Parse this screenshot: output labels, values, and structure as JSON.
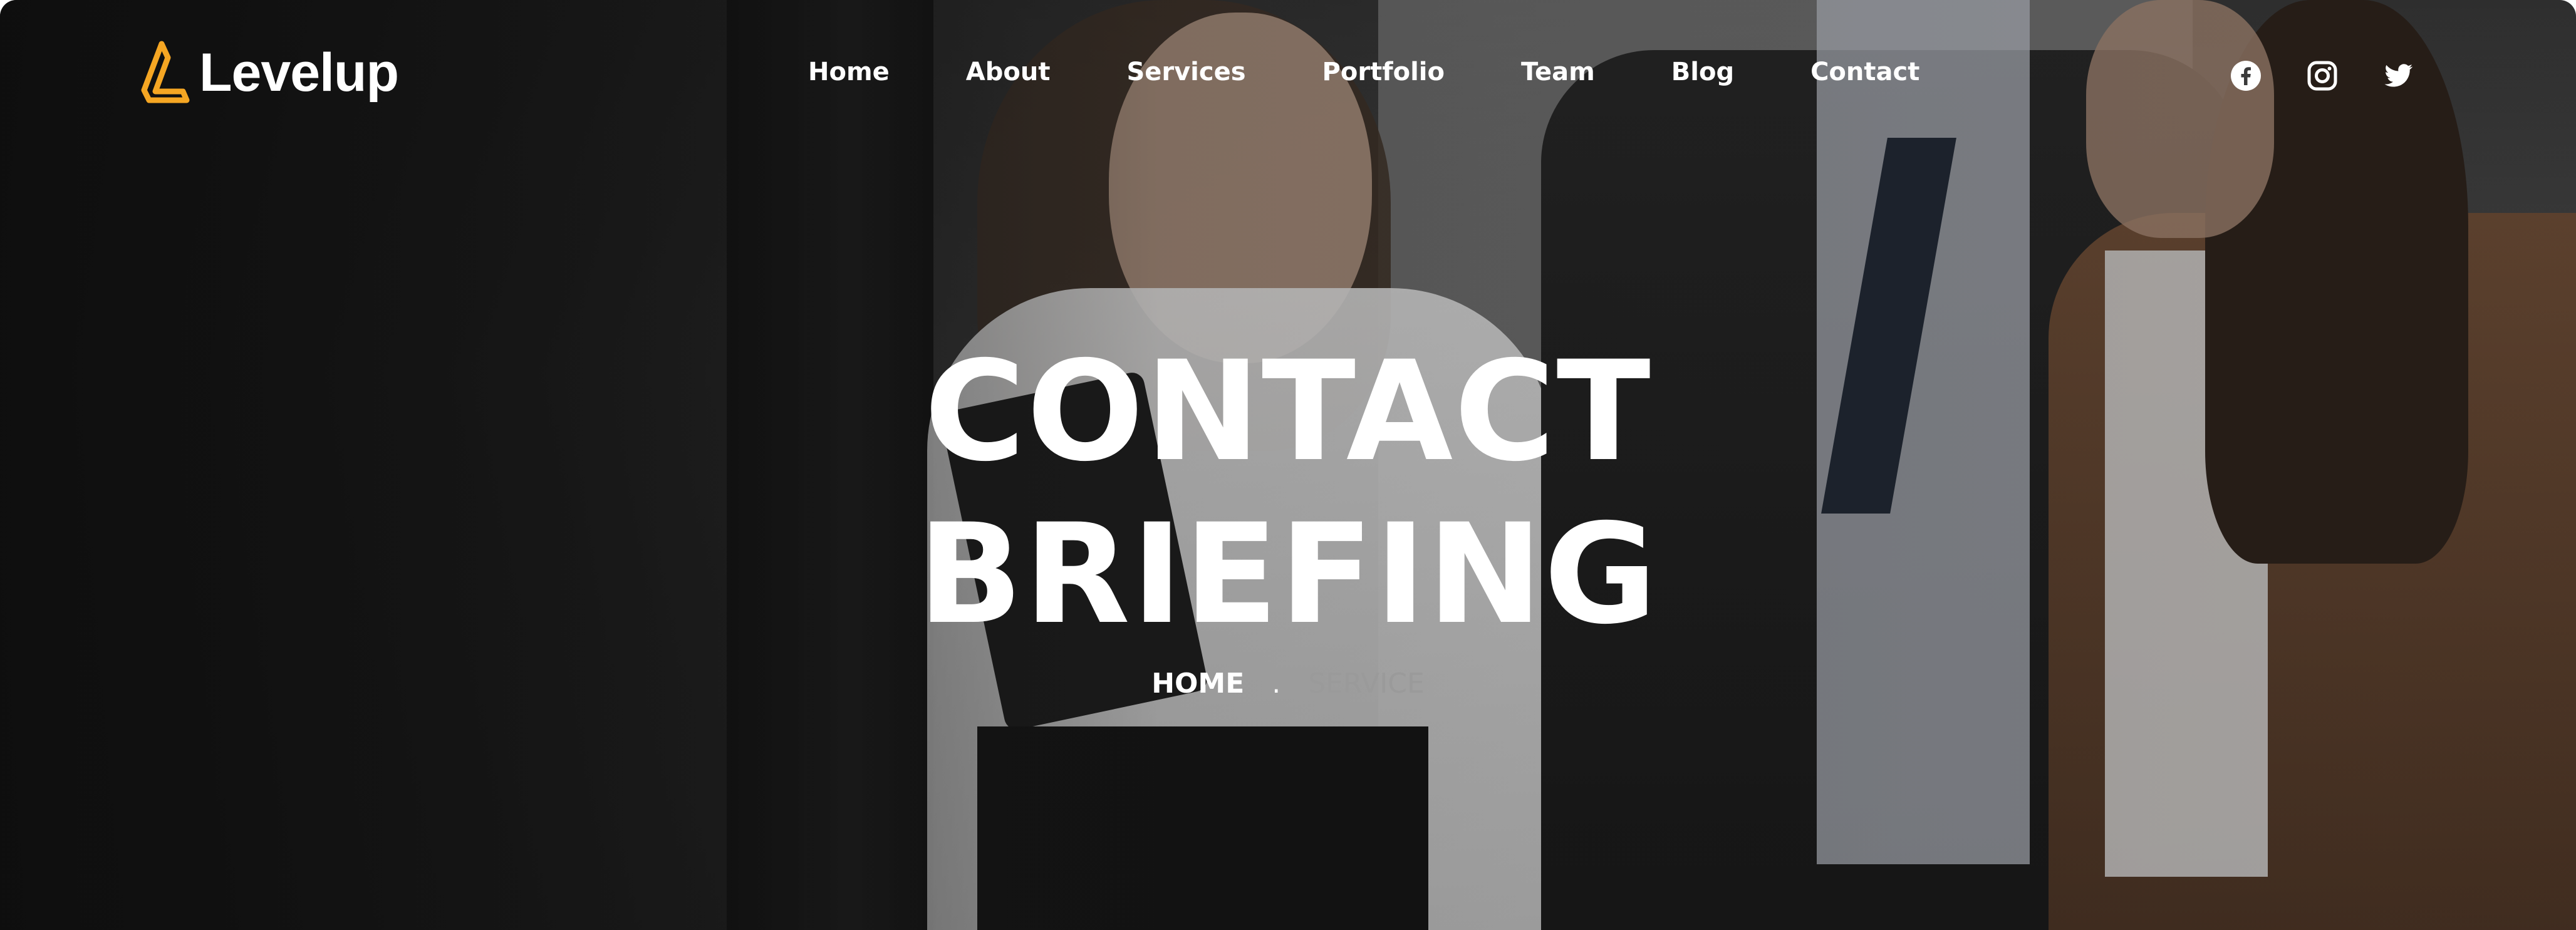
{
  "brand": {
    "name": "Levelup",
    "accent": "#f5a623"
  },
  "nav": {
    "items": [
      {
        "label": "Home"
      },
      {
        "label": "About"
      },
      {
        "label": "Services"
      },
      {
        "label": "Portfolio"
      },
      {
        "label": "Team"
      },
      {
        "label": "Blog"
      },
      {
        "label": "Contact"
      }
    ]
  },
  "social": [
    {
      "icon": "facebook-icon"
    },
    {
      "icon": "instagram-icon"
    },
    {
      "icon": "twitter-icon"
    }
  ],
  "hero": {
    "title_line1": "CONTACT",
    "title_line2": "BRIEFING"
  },
  "breadcrumb": {
    "home": "HOME",
    "separator": ".",
    "current": "SERVICE"
  }
}
